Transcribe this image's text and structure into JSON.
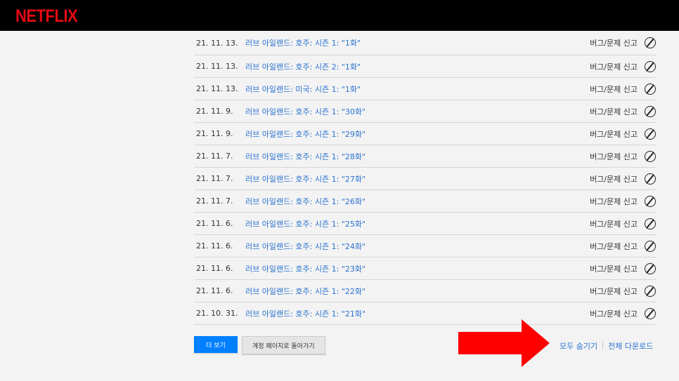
{
  "header": {
    "logo": "NETFLIX"
  },
  "rows": [
    {
      "date": "21. 11. 13.",
      "title": "러브 아일랜드: 호주: 시즌 1: \"1화\"",
      "report": "버그/문제 신고"
    },
    {
      "date": "21. 11. 13.",
      "title": "러브 아일랜드: 호주: 시즌 2: \"1화\"",
      "report": "버그/문제 신고"
    },
    {
      "date": "21. 11. 13.",
      "title": "러브 아일랜드: 미국: 시즌 1: \"1화\"",
      "report": "버그/문제 신고"
    },
    {
      "date": "21. 11. 9.",
      "title": "러브 아일랜드: 호주: 시즌 1: \"30화\"",
      "report": "버그/문제 신고"
    },
    {
      "date": "21. 11. 9.",
      "title": "러브 아일랜드: 호주: 시즌 1: \"29화\"",
      "report": "버그/문제 신고"
    },
    {
      "date": "21. 11. 7.",
      "title": "러브 아일랜드: 호주: 시즌 1: \"28화\"",
      "report": "버그/문제 신고"
    },
    {
      "date": "21. 11. 7.",
      "title": "러브 아일랜드: 호주: 시즌 1: \"27화\"",
      "report": "버그/문제 신고"
    },
    {
      "date": "21. 11. 7.",
      "title": "러브 아일랜드: 호주: 시즌 1: \"26화\"",
      "report": "버그/문제 신고"
    },
    {
      "date": "21. 11. 6.",
      "title": "러브 아일랜드: 호주: 시즌 1: \"25화\"",
      "report": "버그/문제 신고"
    },
    {
      "date": "21. 11. 6.",
      "title": "러브 아일랜드: 호주: 시즌 1: \"24화\"",
      "report": "버그/문제 신고"
    },
    {
      "date": "21. 11. 6.",
      "title": "러브 아일랜드: 호주: 시즌 1: \"23화\"",
      "report": "버그/문제 신고"
    },
    {
      "date": "21. 11. 6.",
      "title": "러브 아일랜드: 호주: 시즌 1: \"22화\"",
      "report": "버그/문제 신고"
    },
    {
      "date": "21. 10. 31.",
      "title": "러브 아일랜드: 호주: 시즌 1: \"21화\"",
      "report": "버그/문제 신고"
    }
  ],
  "buttons": {
    "more": "더 보기",
    "back": "계정 페이지로 돌아가기"
  },
  "links": {
    "hide_all": "모두 숨기기",
    "download_all": "전체 다운로드"
  },
  "colors": {
    "brand": "#e50914",
    "link": "#2b73d0",
    "primary": "#0080ff",
    "arrow": "#ff0000"
  }
}
